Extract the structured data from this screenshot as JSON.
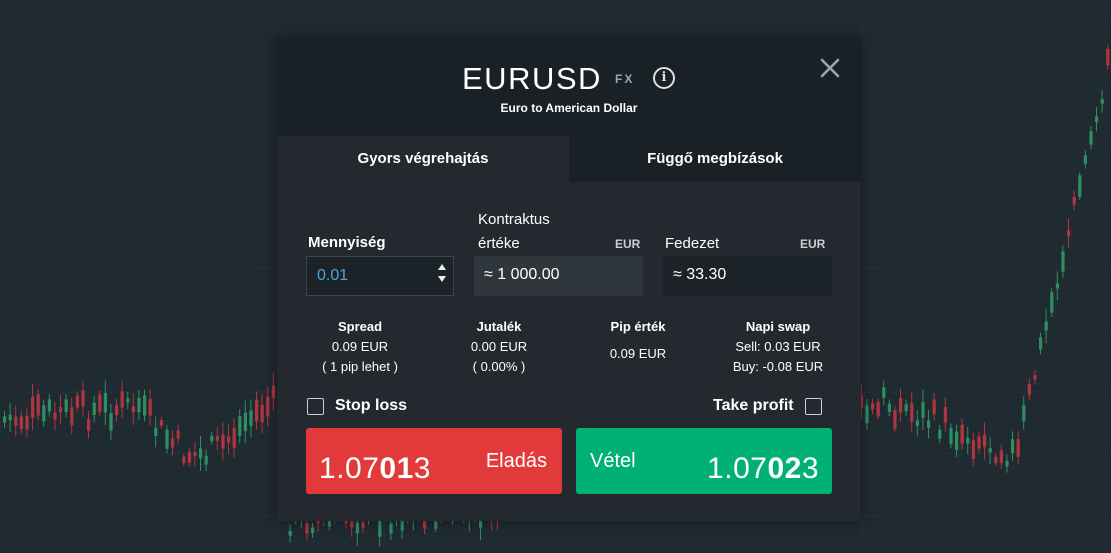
{
  "instrument": {
    "symbol": "EURUSD",
    "type_badge": "FX",
    "description": "Euro to American Dollar"
  },
  "tabs": [
    {
      "label": "Gyors végrehajtás",
      "active": true
    },
    {
      "label": "Függő megbízások",
      "active": false
    }
  ],
  "fields": {
    "quantity": {
      "label": "Mennyiség",
      "value": "0.01"
    },
    "contract_value": {
      "label_line1": "Kontraktus",
      "label_line2": "értéke",
      "unit": "EUR",
      "value": "≈ 1 000.00"
    },
    "margin": {
      "label": "Fedezet",
      "unit": "EUR",
      "value": "≈  33.30"
    }
  },
  "stats": {
    "spread": {
      "title": "Spread",
      "line1": "0.09 EUR",
      "line2": "( 1 pip lehet )"
    },
    "commission": {
      "title": "Jutalék",
      "line1": "0.00 EUR",
      "line2": "( 0.00% )"
    },
    "pip_value": {
      "title": "Pip érték",
      "line1": "0.09 EUR"
    },
    "swap": {
      "title": "Napi swap",
      "line1": "Sell: 0.03 EUR",
      "line2": "Buy: -0.08 EUR"
    }
  },
  "options": {
    "stop_loss": {
      "label": "Stop loss",
      "checked": false
    },
    "take_profit": {
      "label": "Take profit",
      "checked": false
    }
  },
  "sell": {
    "label": "Eladás",
    "price_prefix": "1.07",
    "price_big": "01",
    "price_suffix": "3",
    "color": "#e23a3a"
  },
  "buy": {
    "label": "Vétel",
    "price_prefix": "1.07",
    "price_big": "02",
    "price_suffix": "3",
    "color": "#00b173"
  },
  "colors": {
    "background": "#1f2a31",
    "modal": "#23292e",
    "header": "#1a2126",
    "bull_candle": "#2e8f63",
    "bear_candle": "#b2343f",
    "accent_input": "#4fa3e0"
  }
}
